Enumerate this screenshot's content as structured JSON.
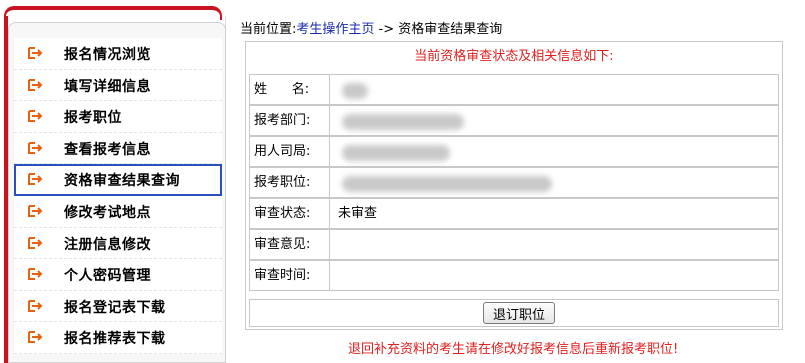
{
  "sidebar": {
    "items": [
      {
        "label": "报名情况浏览"
      },
      {
        "label": "填写详细信息"
      },
      {
        "label": "报考职位"
      },
      {
        "label": "查看报考信息"
      },
      {
        "label": "资格审查结果查询",
        "active": true
      },
      {
        "label": "修改考试地点"
      },
      {
        "label": "注册信息修改"
      },
      {
        "label": "个人密码管理"
      },
      {
        "label": "报名登记表下载"
      },
      {
        "label": "报名推荐表下载"
      }
    ]
  },
  "breadcrumb": {
    "prefix": "当前位置:",
    "home": "考生操作主页",
    "separator": " ->",
    "current": "资格审查结果查询"
  },
  "panel": {
    "title": "当前资格审查状态及相关信息如下:",
    "fields": {
      "name": {
        "label": "姓      名:"
      },
      "department": {
        "label": "报考部门:"
      },
      "employer": {
        "label": "用人司局:"
      },
      "position": {
        "label": "报考职位:"
      },
      "status": {
        "label": "审查状态:",
        "value": "未审查"
      },
      "opinion": {
        "label": "审查意见:",
        "value": ""
      },
      "time": {
        "label": "审查时间:",
        "value": ""
      }
    },
    "withdraw_button": "退订职位"
  },
  "notice": "退回补充资料的考生请在修改好报考信息后重新报考职位!",
  "colors": {
    "accent_red": "#c8141e",
    "link_blue": "#1a2bb0",
    "notice_red": "#e0201f",
    "active_border": "#2a4fbf"
  },
  "icons": {
    "menu_item": "arrow-exit-icon"
  }
}
